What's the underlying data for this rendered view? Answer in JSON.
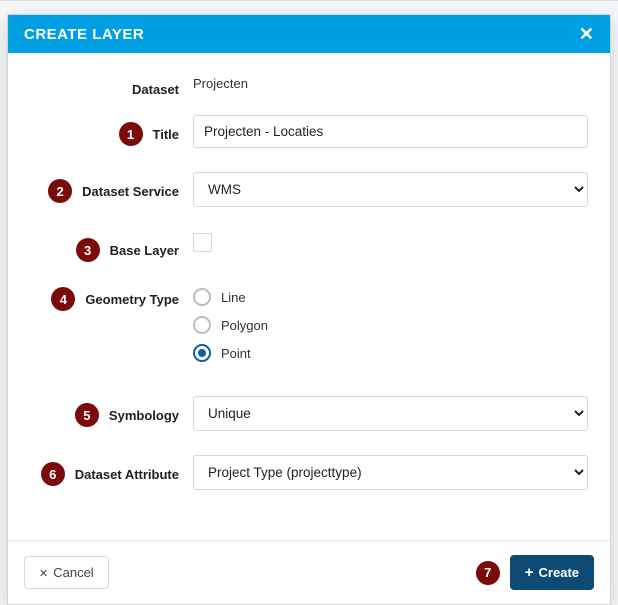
{
  "modal": {
    "title": "CREATE LAYER"
  },
  "labels": {
    "dataset": "Dataset",
    "title": "Title",
    "dataset_service": "Dataset Service",
    "base_layer": "Base Layer",
    "geometry_type": "Geometry Type",
    "symbology": "Symbology",
    "dataset_attribute": "Dataset Attribute"
  },
  "values": {
    "dataset": "Projecten",
    "title_input": "Projecten - Locaties",
    "dataset_service_selected": "WMS",
    "symbology_selected": "Unique",
    "dataset_attribute_selected": "Project Type (projecttype)"
  },
  "geometry_options": {
    "line": "Line",
    "polygon": "Polygon",
    "point": "Point"
  },
  "buttons": {
    "cancel": "Cancel",
    "create": "Create"
  },
  "badges": {
    "b1": "1",
    "b2": "2",
    "b3": "3",
    "b4": "4",
    "b5": "5",
    "b6": "6",
    "b7": "7"
  }
}
